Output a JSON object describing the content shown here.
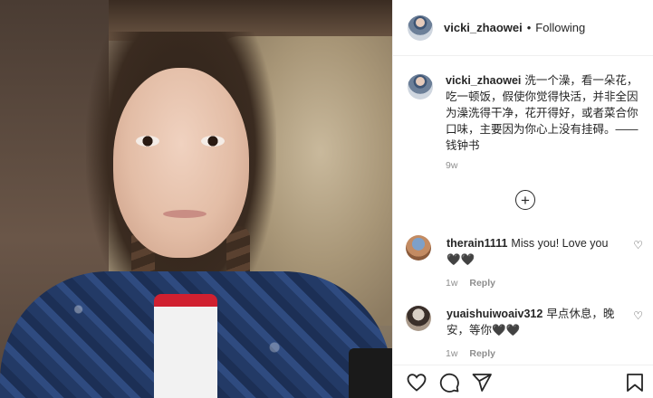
{
  "post": {
    "username": "vicki_zhaowei",
    "follow_separator": "•",
    "follow_status": "Following",
    "caption": "洗一个澡，看一朵花，吃一顿饭，假使你觉得快活，并非全因为澡洗得干净，花开得好，或者菜合你口味，主要因为你心上没有挂碍。——钱钟书",
    "time_ago": "9w",
    "load_more_icon": "plus-circle-icon"
  },
  "comments": [
    {
      "username": "therain1111",
      "text": "Miss you! Love you 🖤🖤",
      "time": "1w",
      "reply_label": "Reply"
    },
    {
      "username": "yuaishuiwoaiv312",
      "text": "早点休息，晚安，等你🖤🖤",
      "time": "1w",
      "reply_label": "Reply"
    }
  ],
  "actions": {
    "icons": [
      "heart-icon",
      "comment-icon",
      "share-icon",
      "bookmark-icon"
    ]
  }
}
